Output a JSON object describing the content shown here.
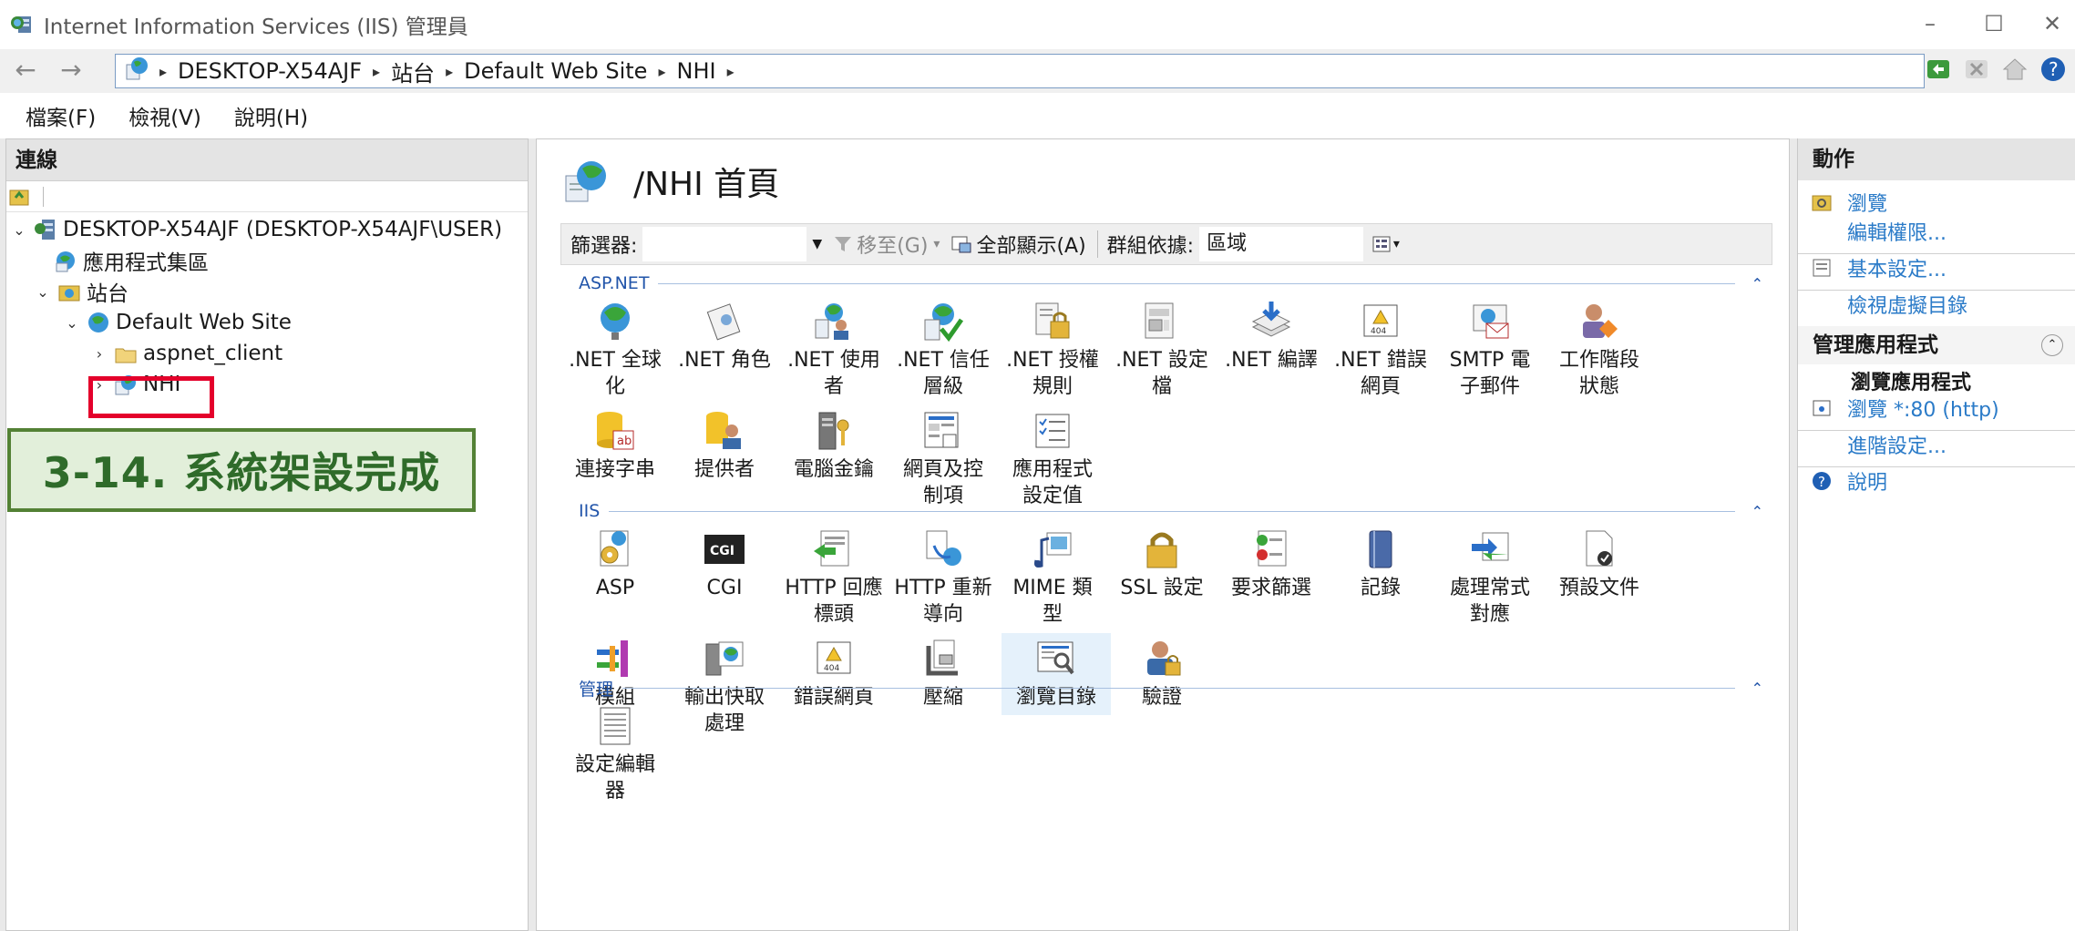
{
  "window": {
    "title": "Internet Information Services (IIS) 管理員",
    "controls": {
      "minimize": "–",
      "maximize": "☐",
      "close": "✕"
    }
  },
  "address": {
    "back": "←",
    "forward": "→",
    "crumbs": [
      "DESKTOP-X54AJF",
      "站台",
      "Default Web Site",
      "NHI"
    ],
    "sep": "▸"
  },
  "menu": [
    "檔案(F)",
    "檢視(V)",
    "說明(H)"
  ],
  "connections": {
    "header": "連線",
    "tree": [
      {
        "label": "DESKTOP-X54AJF (DESKTOP-X54AJF\\USER)",
        "twisty": "⌄"
      },
      {
        "label": "應用程式集區",
        "twisty": ""
      },
      {
        "label": "站台",
        "twisty": "⌄"
      },
      {
        "label": "Default Web Site",
        "twisty": "⌄"
      },
      {
        "label": "aspnet_client",
        "twisty": "›"
      },
      {
        "label": "NHI",
        "twisty": "›"
      }
    ]
  },
  "banner": {
    "text": "3-14. 系統架設完成"
  },
  "center": {
    "title": "/NHI 首頁",
    "filter": {
      "label": "篩選器:",
      "goto": "移至(G)",
      "showall": "全部顯示(A)",
      "groupby": "群組依據:",
      "groupby_value": "區域"
    },
    "sections": [
      {
        "name": "ASP.NET",
        "items": [
          ".NET 全球\n化",
          ".NET 角色",
          ".NET 使用\n者",
          ".NET 信任\n層級",
          ".NET 授權\n規則",
          ".NET 設定\n檔",
          ".NET 編譯",
          ".NET 錯誤\n網頁",
          "SMTP 電\n子郵件",
          "工作階段\n狀態",
          "連接字串",
          "提供者",
          "電腦金鑰",
          "網頁及控\n制項",
          "應用程式\n設定值"
        ]
      },
      {
        "name": "IIS",
        "items": [
          "ASP",
          "CGI",
          "HTTP 回應\n標頭",
          "HTTP 重新\n導向",
          "MIME 類\n型",
          "SSL 設定",
          "要求篩選",
          "記錄",
          "處理常式\n對應",
          "預設文件",
          "模組",
          "輸出快取\n處理",
          "錯誤網頁",
          "壓縮",
          "瀏覽目錄",
          "驗證"
        ]
      },
      {
        "name": "管理",
        "items": [
          "設定編輯\n器"
        ]
      }
    ],
    "cgi_icon_text": "CGI",
    "icon_404_text": "404",
    "icon_ab_text": "ab"
  },
  "actions": {
    "header": "動作",
    "items": [
      {
        "label": "瀏覽",
        "link": true
      },
      {
        "label": "編輯權限...",
        "link": true
      },
      {
        "label": "基本設定...",
        "link": true
      },
      {
        "label": "檢視虛擬目錄",
        "link": true
      }
    ],
    "manage_group": "管理應用程式",
    "browse_app": "瀏覽應用程式",
    "browse_80": "瀏覽 *:80 (http)",
    "advanced": "進階設定...",
    "help": "說明"
  },
  "colors": {
    "accent": "#2b7bc8",
    "banner_border": "#538135",
    "banner_bg": "#e2efda",
    "selection_red": "#e4002b"
  }
}
